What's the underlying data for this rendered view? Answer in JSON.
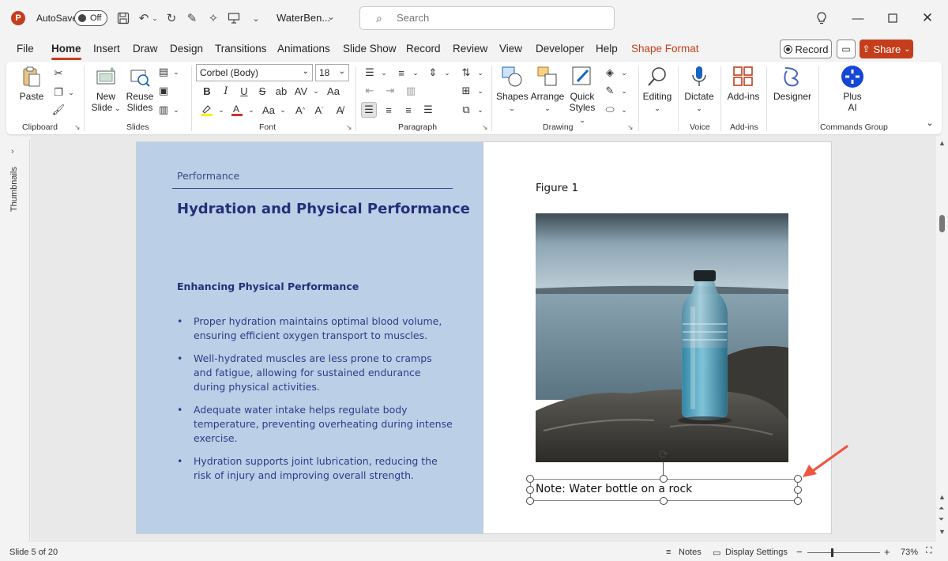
{
  "titlebar": {
    "app_logo": "P",
    "autosave_label": "AutoSave",
    "autosave_state": "Off",
    "doc_title": "WaterBen...",
    "search_placeholder": "Search"
  },
  "menu": {
    "tabs": [
      "File",
      "Home",
      "Insert",
      "Draw",
      "Design",
      "Transitions",
      "Animations",
      "Slide Show",
      "Record",
      "Review",
      "View",
      "Developer",
      "Help",
      "Shape Format"
    ],
    "active_tab": "Home",
    "record_label": "Record",
    "share_label": "Share"
  },
  "ribbon": {
    "clipboard": {
      "paste": "Paste",
      "group": "Clipboard"
    },
    "slides": {
      "new_slide_1": "New",
      "new_slide_2": "Slide",
      "reuse_1": "Reuse",
      "reuse_2": "Slides",
      "group": "Slides"
    },
    "font": {
      "family": "Corbel (Body)",
      "size": "18",
      "bold": "B",
      "italic": "I",
      "underline": "U",
      "strike": "S",
      "group": "Font"
    },
    "paragraph": {
      "group": "Paragraph"
    },
    "drawing": {
      "shapes": "Shapes",
      "arrange": "Arrange",
      "quick_1": "Quick",
      "quick_2": "Styles",
      "group": "Drawing"
    },
    "editing": {
      "label": "Editing"
    },
    "voice": {
      "dictate": "Dictate",
      "group": "Voice"
    },
    "addins": {
      "label": "Add-ins",
      "group": "Add-ins"
    },
    "designer": {
      "label": "Designer"
    },
    "plus_ai": {
      "line1": "Plus",
      "line2": "AI",
      "group": "Commands Group"
    }
  },
  "thumbnails": {
    "label": "Thumbnails"
  },
  "slide": {
    "section_label": "Performance",
    "title": "Hydration and Physical Performance",
    "subtitle": "Enhancing Physical Performance",
    "bullets": [
      "Proper hydration maintains optimal blood volume, ensuring efficient oxygen transport to muscles.",
      "Well-hydrated muscles are less prone to cramps and fatigue, allowing for sustained endurance during physical activities.",
      "Adequate water intake helps regulate body temperature, preventing overheating during intense exercise.",
      "Hydration supports joint lubrication, reducing the risk of injury and improving overall strength."
    ],
    "figure_label": "Figure 1",
    "caption": "Note: Water bottle on a rock"
  },
  "statusbar": {
    "slide_info": "Slide 5 of 20",
    "notes": "Notes",
    "display_settings": "Display Settings",
    "zoom_minus": "−",
    "zoom_plus": "+",
    "zoom": "73%"
  },
  "colors": {
    "accent": "#c43e1c",
    "slide_panel": "#bbcfe6",
    "slide_text": "#252f78",
    "annotation_arrow": "#f0553f"
  }
}
